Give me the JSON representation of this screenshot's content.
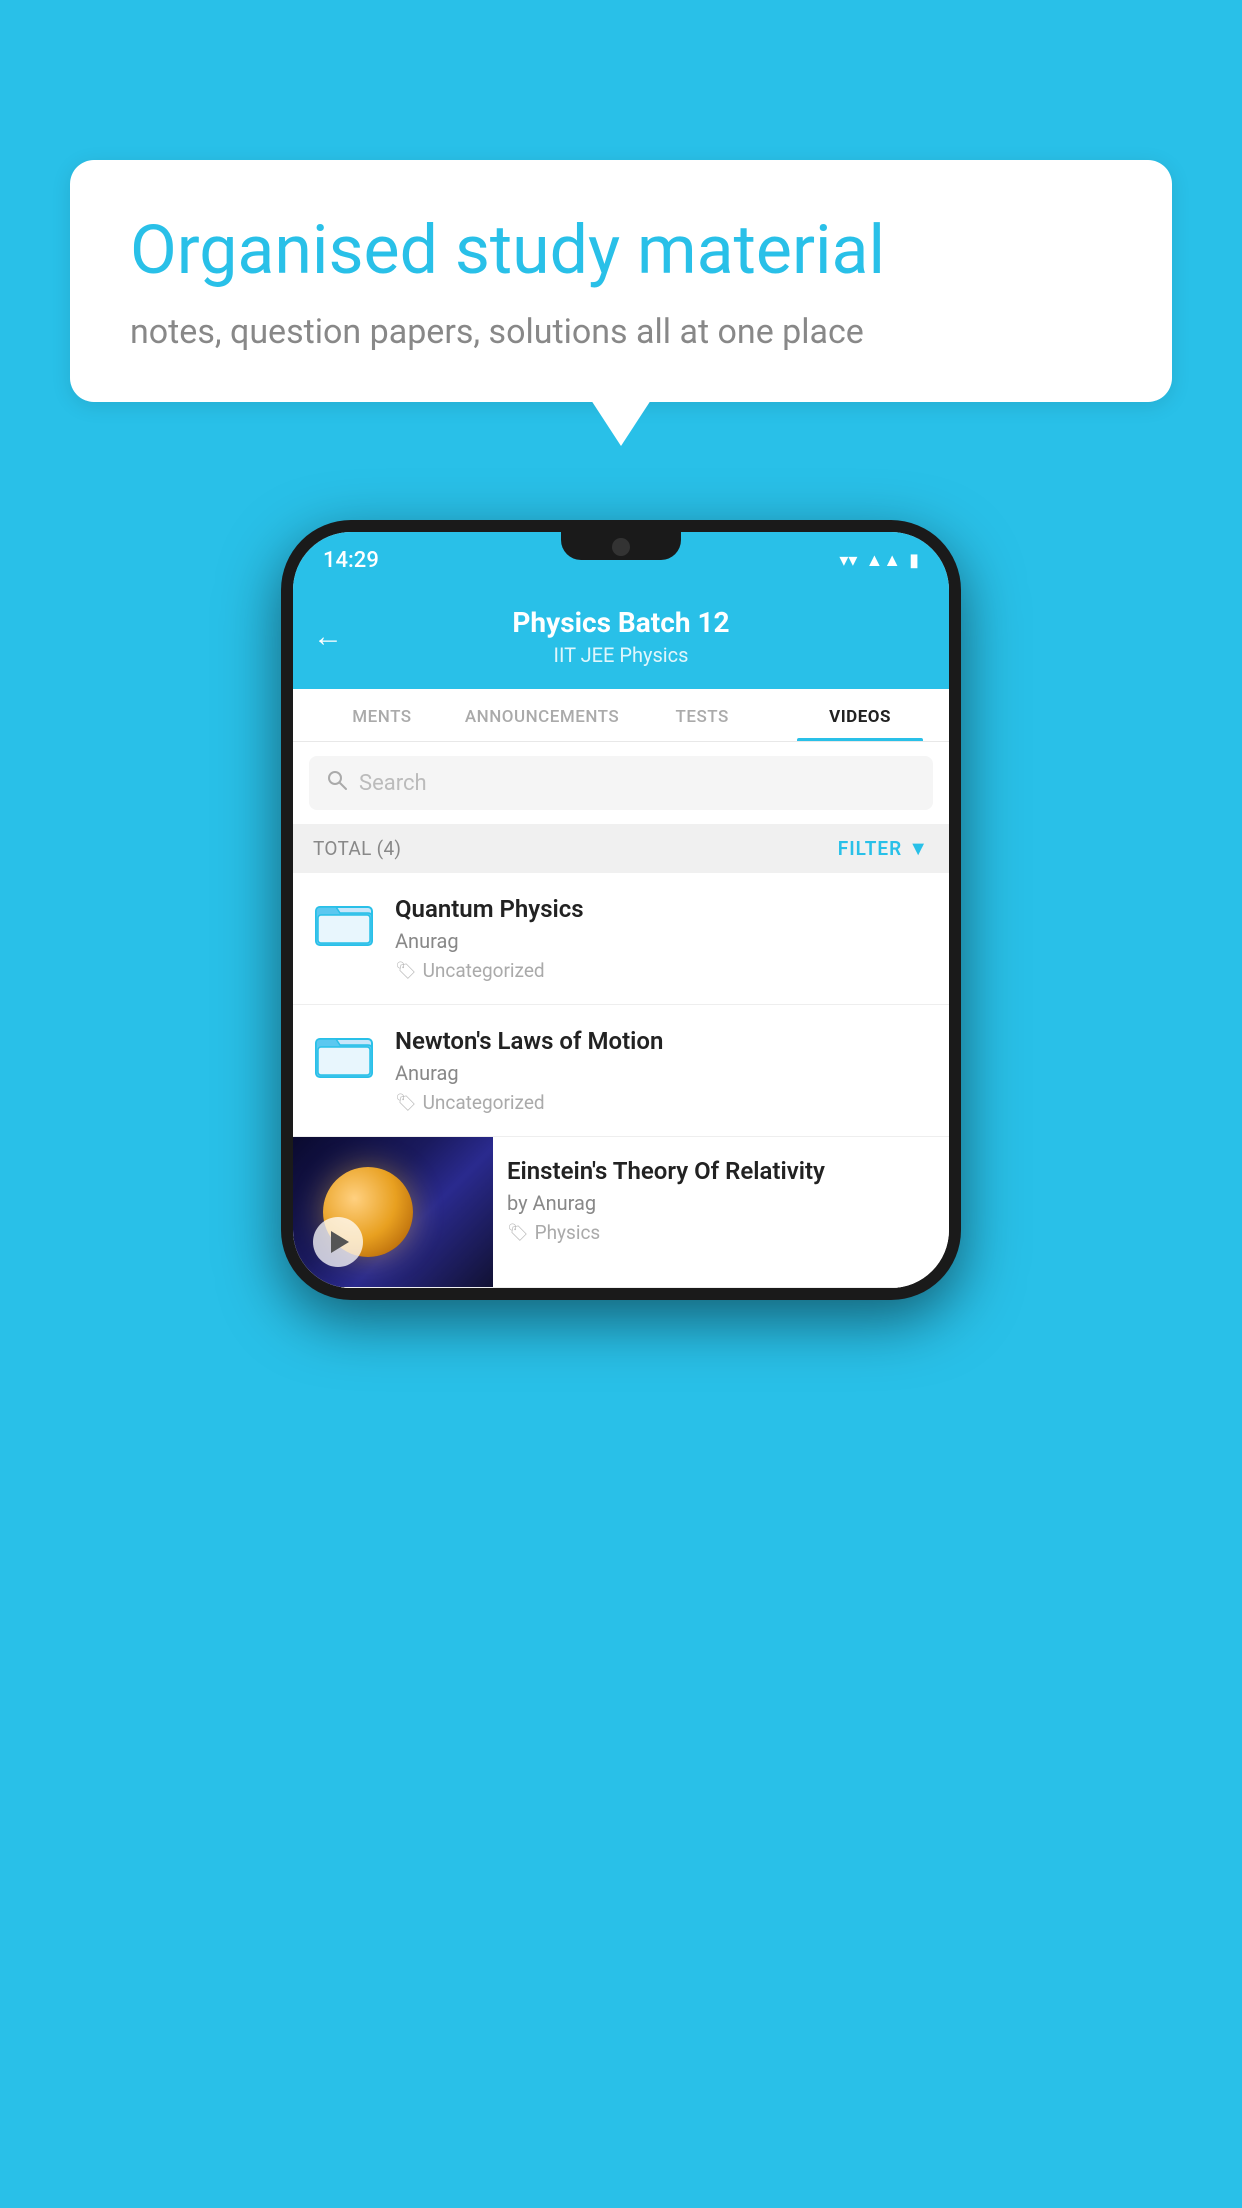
{
  "background": {
    "color": "#29C0E8"
  },
  "speech_bubble": {
    "title": "Organised study material",
    "subtitle": "notes, question papers, solutions all at one place"
  },
  "status_bar": {
    "time": "14:29",
    "wifi": "▼",
    "signal": "▲",
    "battery": "▮"
  },
  "app_header": {
    "back_label": "←",
    "title": "Physics Batch 12",
    "subtitle": "IIT JEE   Physics"
  },
  "tabs": [
    {
      "label": "MENTS",
      "active": false
    },
    {
      "label": "ANNOUNCEMENTS",
      "active": false
    },
    {
      "label": "TESTS",
      "active": false
    },
    {
      "label": "VIDEOS",
      "active": true
    }
  ],
  "search": {
    "placeholder": "Search"
  },
  "filter_bar": {
    "total_label": "TOTAL (4)",
    "filter_label": "FILTER"
  },
  "video_items": [
    {
      "id": 1,
      "title": "Quantum Physics",
      "author": "Anurag",
      "tag": "Uncategorized",
      "has_thumbnail": false
    },
    {
      "id": 2,
      "title": "Newton's Laws of Motion",
      "author": "Anurag",
      "tag": "Uncategorized",
      "has_thumbnail": false
    },
    {
      "id": 3,
      "title": "Einstein's Theory Of Relativity",
      "author": "by Anurag",
      "tag": "Physics",
      "has_thumbnail": true
    }
  ]
}
